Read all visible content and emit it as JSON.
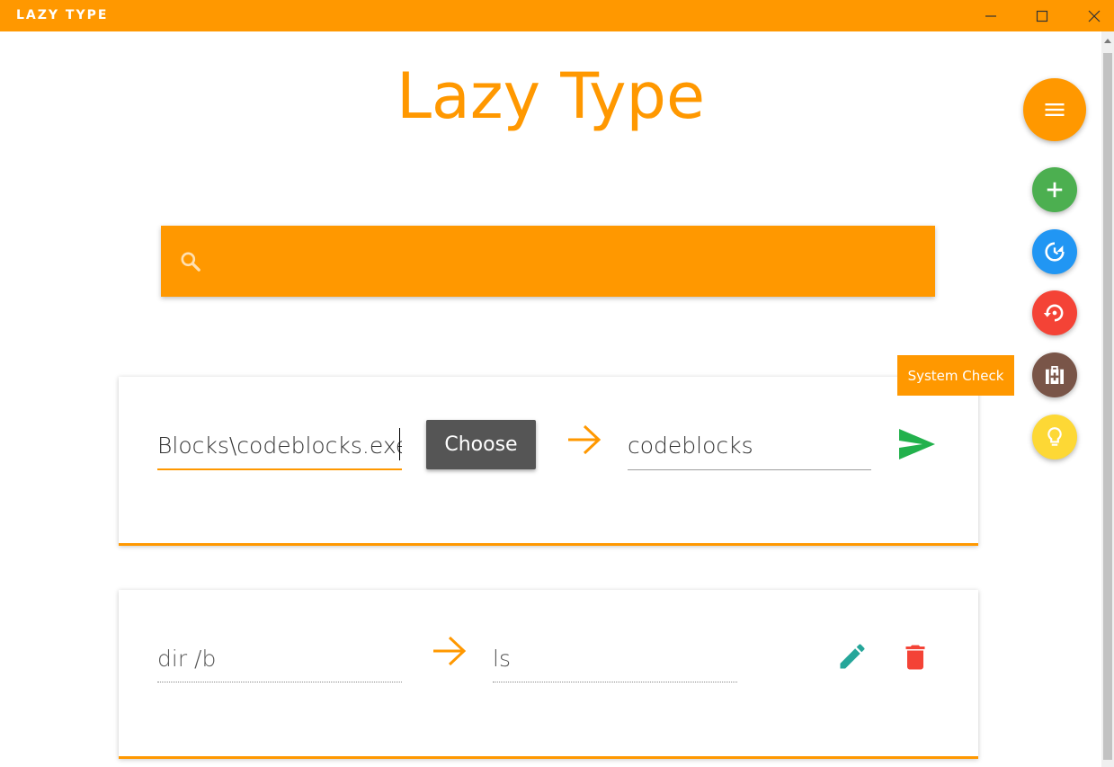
{
  "window": {
    "title": "LAZY TYPE",
    "controls": [
      "minimize",
      "maximize",
      "close"
    ]
  },
  "header": {
    "title": "Lazy Type"
  },
  "search": {
    "placeholder": "",
    "value": "",
    "icon": "search-icon"
  },
  "cards": [
    {
      "mode": "editing",
      "command_value": "Blocks\\codeblocks.exe",
      "choose_label": "Choose",
      "shortcut_value": "codeblocks",
      "action_icon": "send-icon"
    },
    {
      "mode": "saved",
      "command_value": "dir /b",
      "shortcut_value": "ls",
      "action_icons": [
        "edit-icon",
        "delete-icon"
      ]
    }
  ],
  "fab_menu": {
    "main_icon": "menu-icon",
    "items": [
      {
        "name": "add",
        "icon": "plus-icon",
        "color": "#4caf50"
      },
      {
        "name": "backup",
        "icon": "backup-icon",
        "color": "#2196f3"
      },
      {
        "name": "restore",
        "icon": "restore-icon",
        "color": "#f44336"
      },
      {
        "name": "system-check",
        "icon": "medical-kit-icon",
        "color": "#795548",
        "tooltip": "System Check"
      },
      {
        "name": "tips",
        "icon": "lightbulb-icon",
        "color": "#fdd835"
      }
    ]
  },
  "colors": {
    "accent": "#ff9800",
    "send": "#22b14c",
    "edit": "#26a69a",
    "delete": "#f44336"
  }
}
